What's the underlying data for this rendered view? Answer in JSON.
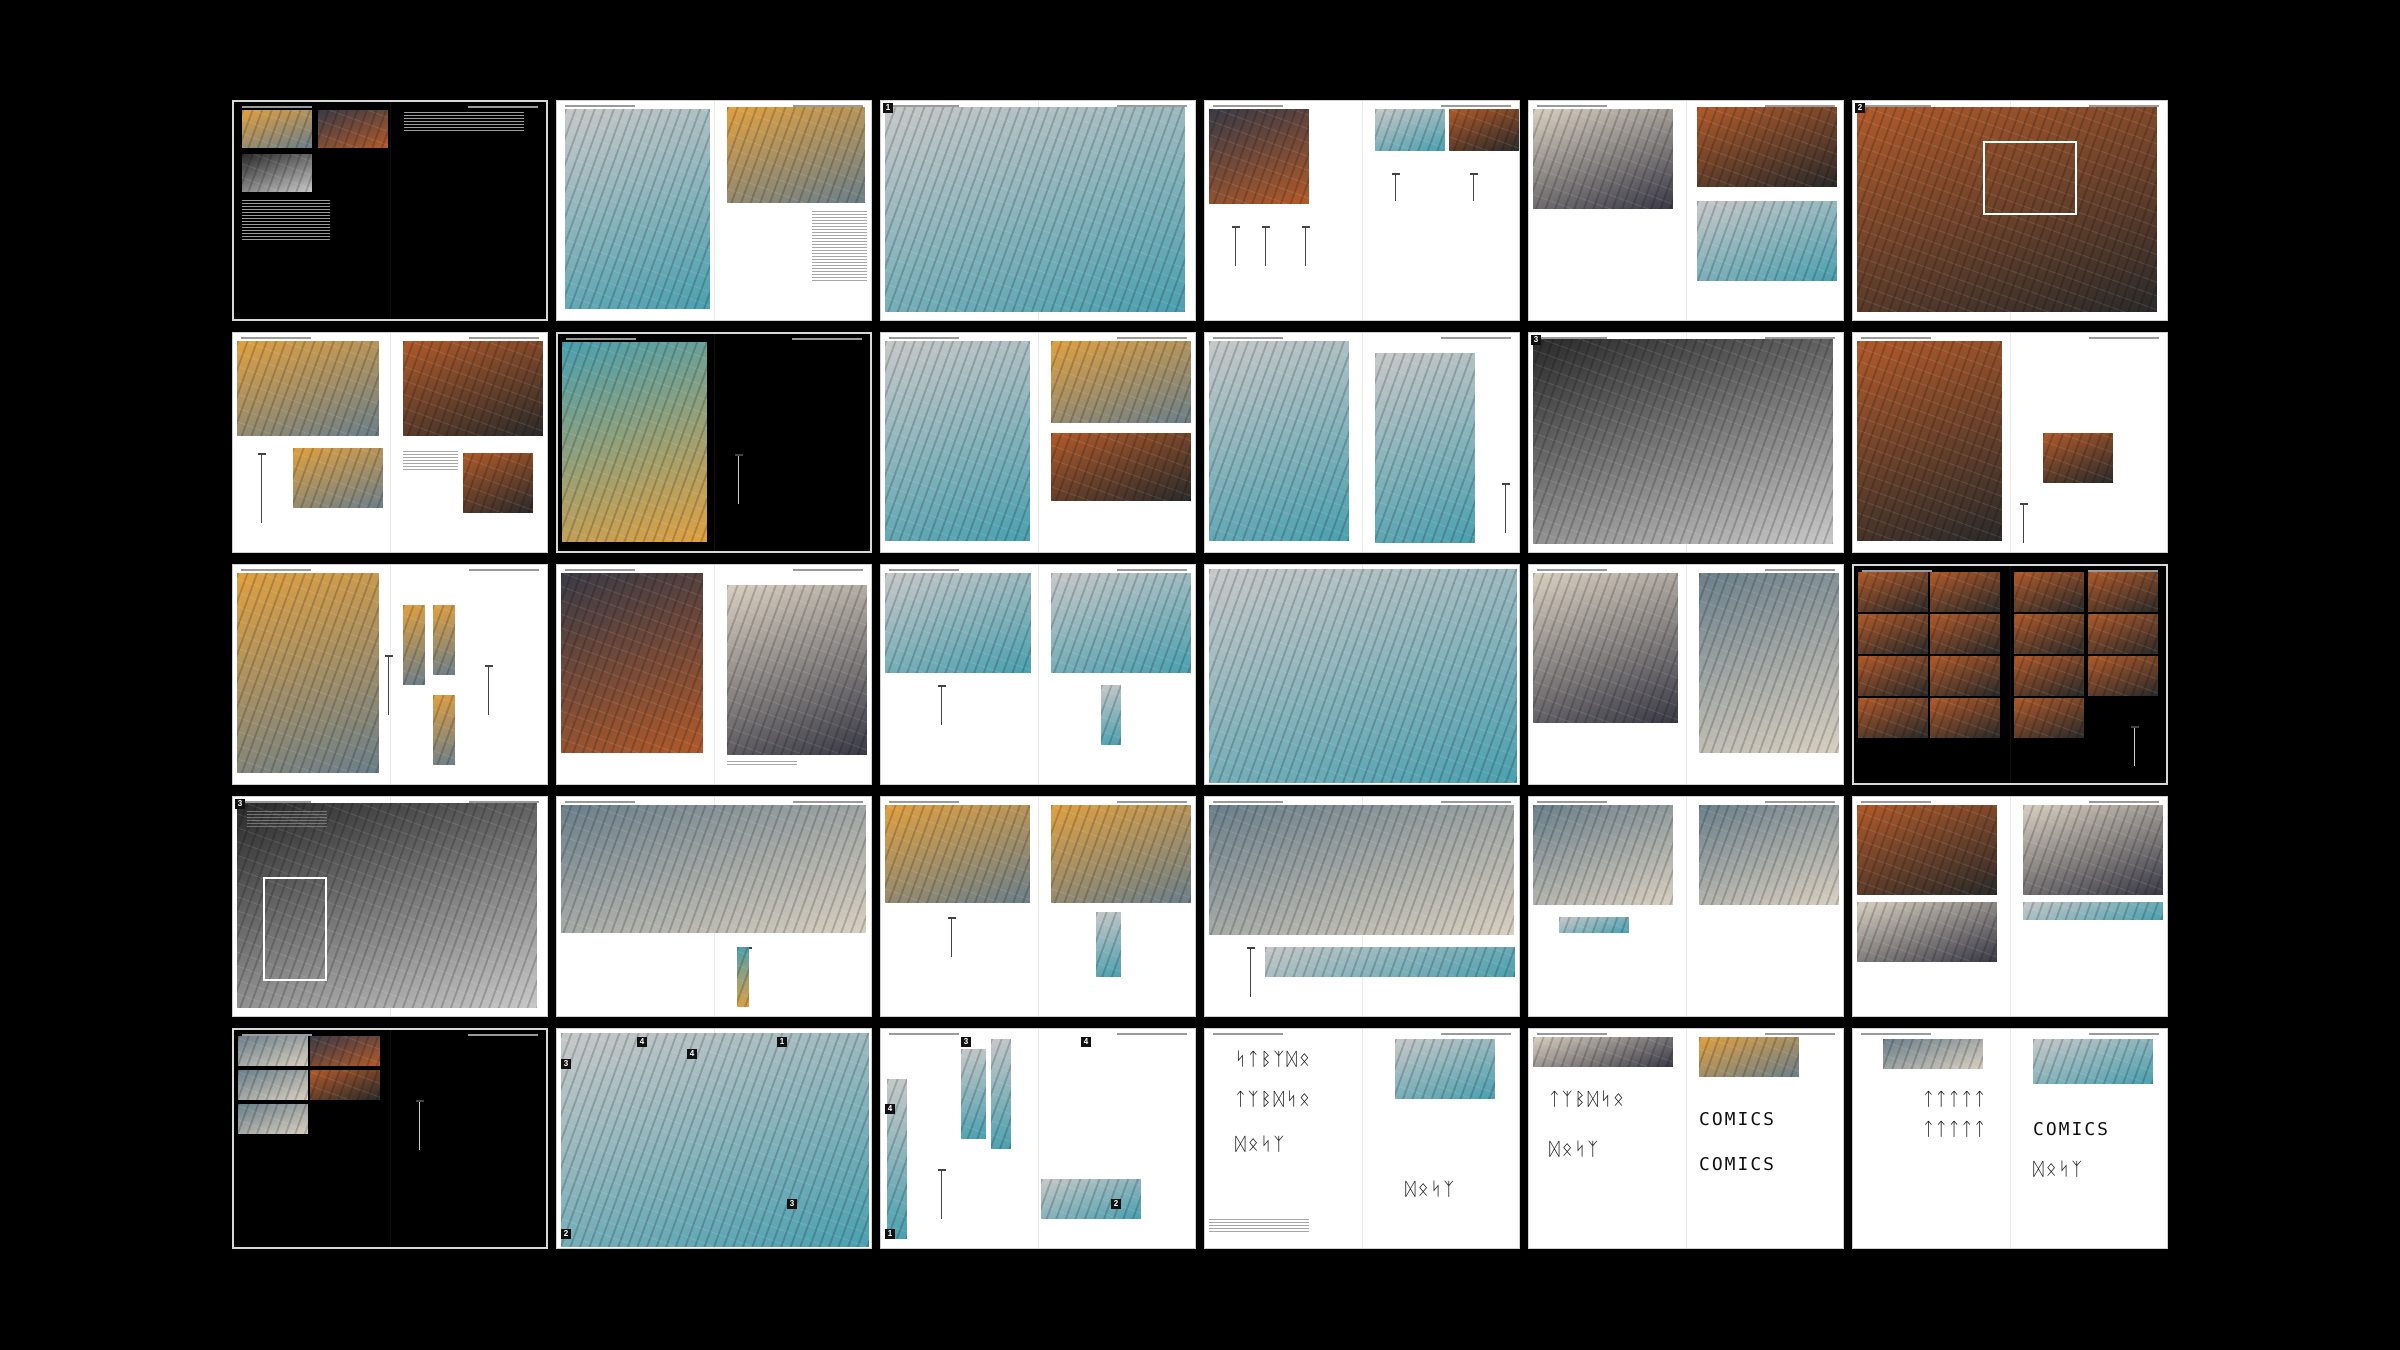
{
  "colors": {
    "background": "#000000",
    "page": "#ffffff",
    "dark_page": "#000000",
    "photo_palette": [
      "#e0a040",
      "#3a3a46",
      "#c8c8c8",
      "#6b7f8a",
      "#b05a2a",
      "#4aa0b0",
      "#d8cfc0",
      "#2a2a2a"
    ]
  },
  "badges": [
    "1",
    "2",
    "3",
    "3",
    "3",
    "4",
    "4",
    "1",
    "2",
    "3",
    "3",
    "4",
    "4",
    "1"
  ],
  "glyph_lines": [
    "ᛋᛏᛒᛉᛞᛟ",
    "ᛏᛉᛒᛞᛋᛟ",
    "ᛞᛟᛋᛉ",
    "COMICS",
    "ᛏᛏᛏᛏᛏ"
  ]
}
